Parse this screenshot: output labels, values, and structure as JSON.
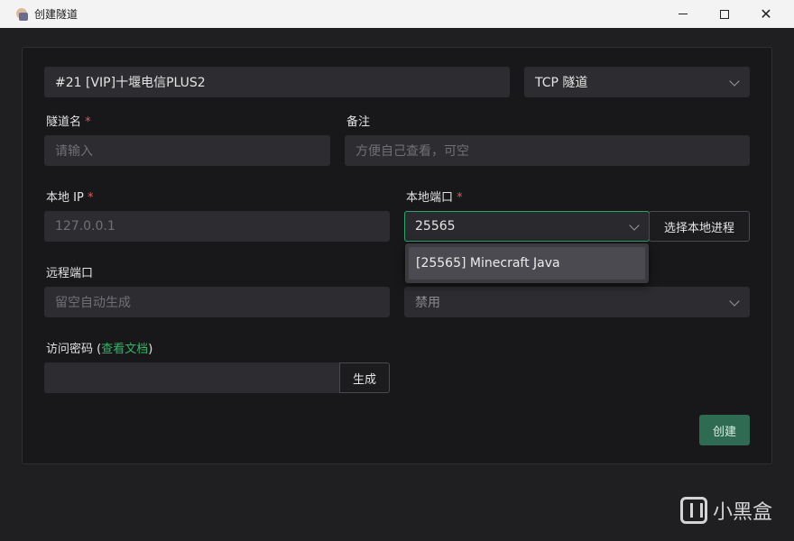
{
  "window": {
    "title": "创建隧道"
  },
  "node": {
    "value": "#21 [VIP]十堰电信PLUS2"
  },
  "protocol": {
    "value": "TCP 隧道"
  },
  "tunnel_name": {
    "label": "隧道名",
    "required_mark": "*",
    "placeholder": "请输入"
  },
  "remark": {
    "label": "备注",
    "placeholder": "方便自己查看，可空"
  },
  "local_ip": {
    "label": "本地 IP",
    "required_mark": "*",
    "placeholder": "127.0.0.1"
  },
  "local_port": {
    "label": "本地端口",
    "required_mark": "*",
    "value": "25565",
    "select_process_label": "选择本地进程",
    "dropdown_options": [
      "[25565] Minecraft Java"
    ]
  },
  "remote_port": {
    "label": "远程端口",
    "placeholder": "留空自动生成"
  },
  "second_select": {
    "value": "禁用"
  },
  "access_password": {
    "label_prefix": "访问密码 (",
    "doc_link": "查看文档",
    "label_suffix": ")",
    "generate_label": "生成"
  },
  "create_label": "创建",
  "watermark": {
    "text": "小黑盒"
  },
  "colors": {
    "accent": "#2fa36a",
    "create_button": "#2e6b52",
    "required": "#e05a5a"
  }
}
